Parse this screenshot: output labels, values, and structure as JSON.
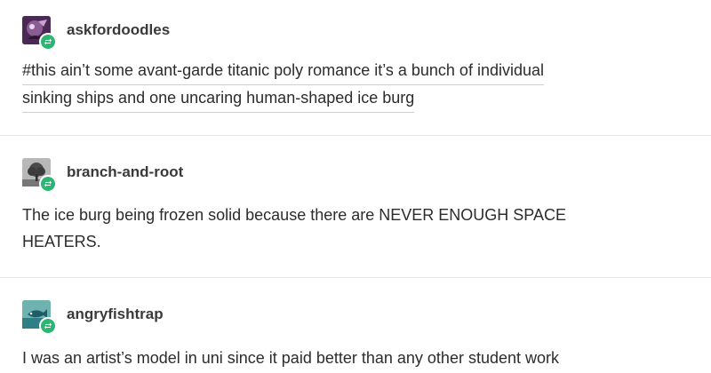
{
  "posts": [
    {
      "username": "askfordoodles",
      "avatar_icon": "purple-character-avatar",
      "lines": [
        "#this ain’t some avant-garde titanic poly romance it’s a bunch of individual",
        "sinking ships and one uncaring human-shaped ice burg"
      ]
    },
    {
      "username": "branch-and-root",
      "avatar_icon": "tree-avatar",
      "lines": [
        "The ice burg being frozen solid because there are NEVER ENOUGH SPACE",
        "HEATERS."
      ]
    },
    {
      "username": "angryfishtrap",
      "avatar_icon": "teal-fish-avatar",
      "lines": [
        "I was an artist’s model in uni since it paid better than any other student work"
      ]
    }
  ],
  "colors": {
    "badge": "#2bb673",
    "divider": "#e6e6e6"
  },
  "badge_icon": "reblog-icon"
}
